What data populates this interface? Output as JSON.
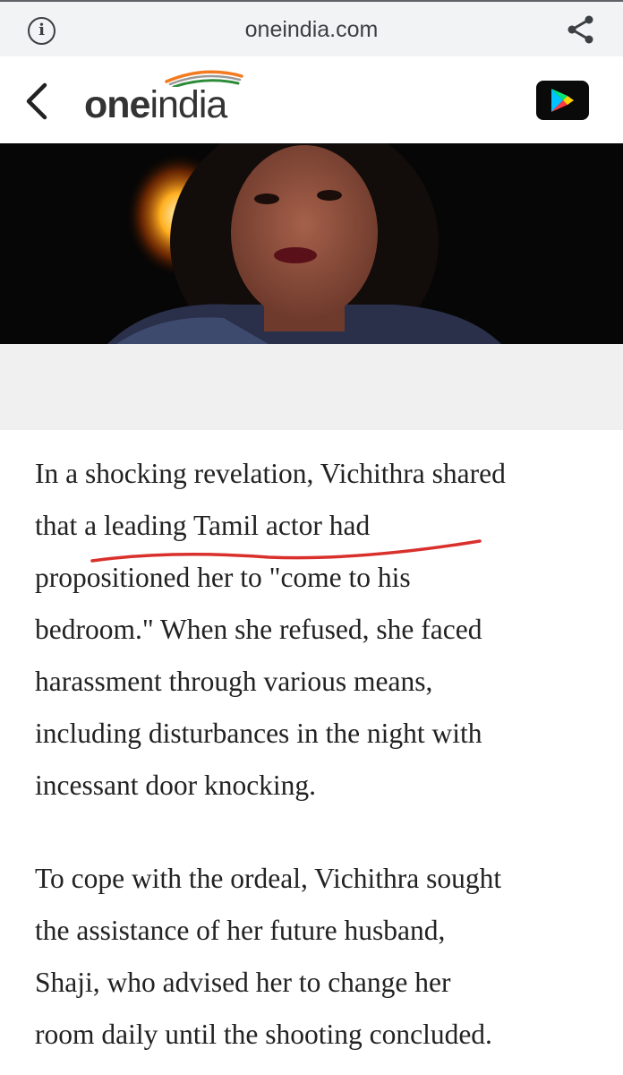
{
  "browser": {
    "url": "oneindia.com",
    "info_icon": "info-icon",
    "share_icon": "share-icon"
  },
  "header": {
    "back_icon": "chevron-left-icon",
    "logo_one": "one",
    "logo_india": "india",
    "play_icon": "google-play-icon"
  },
  "hero": {
    "description_icon": "article-hero-image"
  },
  "article": {
    "paragraphs": [
      "In a shocking revelation, Vichithra shared\nthat a leading Tamil actor had\npropositioned her to \"come to his\nbedroom.\" When she refused, she faced\nharassment through various means,\nincluding disturbances in the night with\nincessant door knocking.",
      "To cope with the ordeal, Vichithra sought\nthe assistance of her future husband,\nShaji, who advised her to change her\nroom daily until the shooting concluded."
    ]
  },
  "colors": {
    "underline": "#d9302c",
    "text": "#222222",
    "urlbar_bg": "#f1f3f4"
  }
}
